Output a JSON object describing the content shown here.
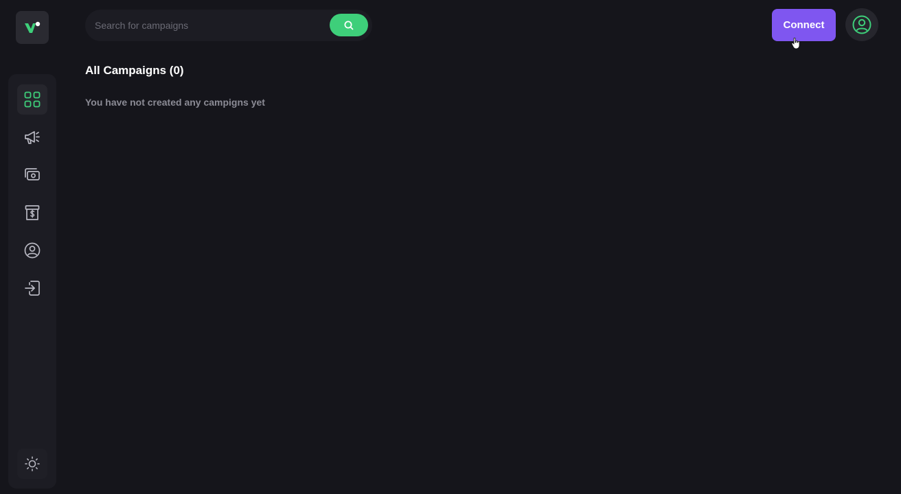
{
  "search": {
    "placeholder": "Search for campaigns",
    "value": ""
  },
  "header": {
    "connect_label": "Connect"
  },
  "main": {
    "title": "All Campaigns (0)",
    "empty_message": "You have not created any campigns yet"
  },
  "sidebar": {
    "items": [
      {
        "icon": "dashboard-grid-icon",
        "active": true
      },
      {
        "icon": "megaphone-icon",
        "active": false
      },
      {
        "icon": "money-icon",
        "active": false
      },
      {
        "icon": "store-dollar-icon",
        "active": false
      },
      {
        "icon": "user-circle-icon",
        "active": false
      },
      {
        "icon": "logout-icon",
        "active": false
      }
    ]
  },
  "colors": {
    "background": "#15151b",
    "accent_green": "#3ecf7a",
    "accent_purple": "#7f56f0",
    "muted_text": "#8b8b95"
  }
}
